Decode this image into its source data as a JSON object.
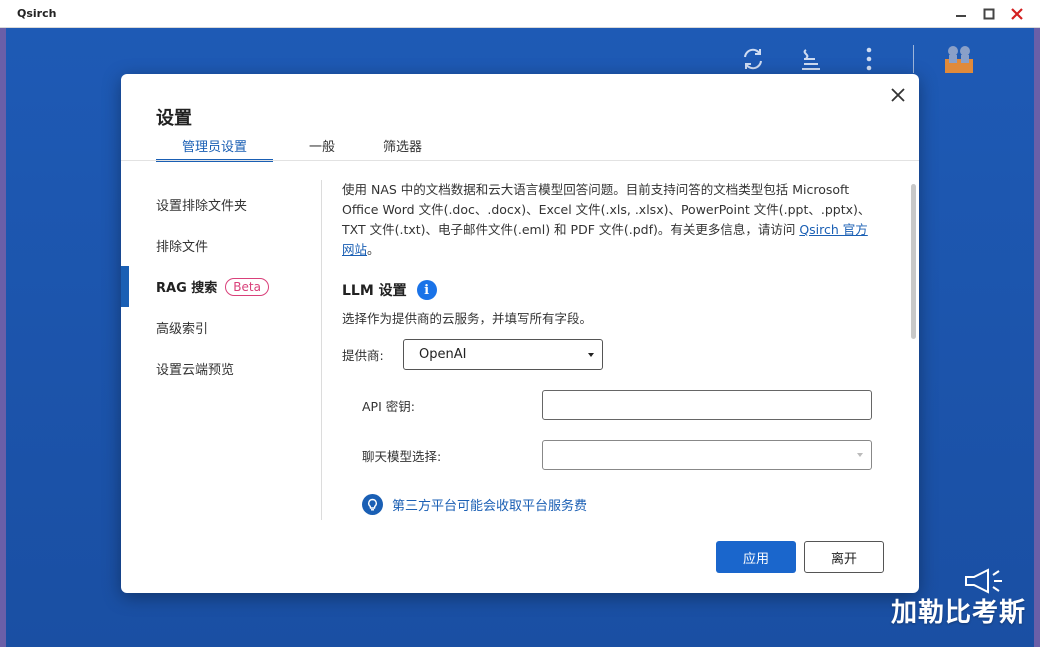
{
  "window": {
    "title": "Qsirch"
  },
  "dialog": {
    "title": "设置",
    "tabs": [
      "管理员设置",
      "一般",
      "筛选器"
    ],
    "sidebar": {
      "items": [
        "设置排除文件夹",
        "排除文件",
        "RAG 搜索",
        "高级索引",
        "设置云端预览"
      ],
      "badge": "Beta"
    },
    "content": {
      "intro_text": "使用 NAS 中的文档数据和云大语言模型回答问题。目前支持问答的文档类型包括 Microsoft Office Word 文件(.doc、.docx)、Excel 文件(.xls, .xlsx)、PowerPoint 文件(.ppt、.pptx)、TXT 文件(.txt)、电子邮件文件(.eml) 和 PDF 文件(.pdf)。有关更多信息，请访问 ",
      "intro_link": "Qsirch 官方网站",
      "intro_end": "。",
      "llm_title": "LLM 设置",
      "llm_desc": "选择作为提供商的云服务，并填写所有字段。",
      "provider_label": "提供商:",
      "provider_value": "OpenAI",
      "api_key_label": "API 密钥:",
      "api_key_value": "",
      "chat_model_label": "聊天模型选择:",
      "chat_model_value": "",
      "tip": "第三方平台可能会收取平台服务费"
    },
    "buttons": {
      "apply": "应用",
      "leave": "离开"
    }
  },
  "watermark": "加勒比考斯",
  "colors": {
    "accent": "#1a5fb4",
    "badge": "#d9407a",
    "background": "#1d56b0"
  }
}
